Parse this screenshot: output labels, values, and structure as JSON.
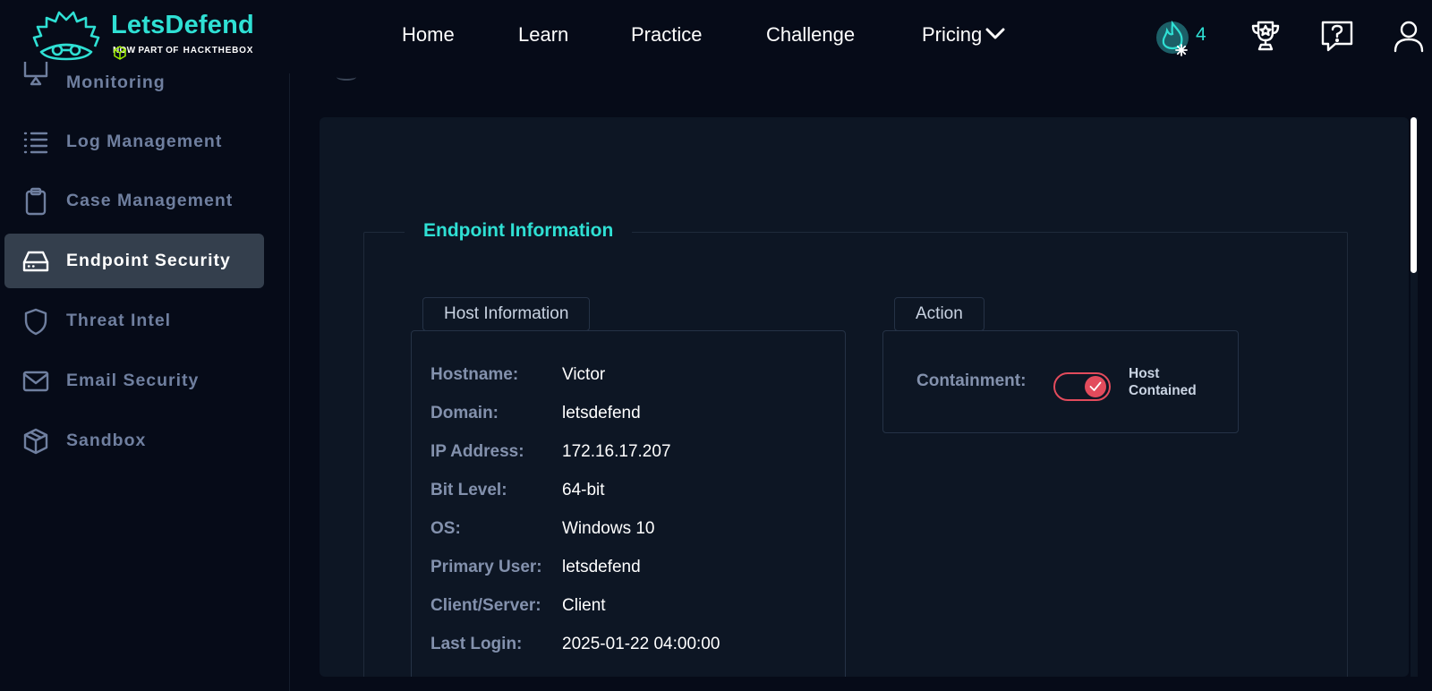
{
  "brand": {
    "name": "LetsDefend",
    "tagline": "NOW PART OF",
    "partner": "HACKTHEBOX"
  },
  "nav": {
    "items": [
      {
        "label": "Home"
      },
      {
        "label": "Learn"
      },
      {
        "label": "Practice"
      },
      {
        "label": "Challenge"
      },
      {
        "label": "Pricing"
      }
    ]
  },
  "streak": {
    "count": "4"
  },
  "sidebar": {
    "items": [
      {
        "label": "Monitoring",
        "icon": "monitor-icon"
      },
      {
        "label": "Log Management",
        "icon": "list-icon"
      },
      {
        "label": "Case Management",
        "icon": "clipboard-icon"
      },
      {
        "label": "Endpoint Security",
        "icon": "hard-drive-icon",
        "active": true
      },
      {
        "label": "Threat Intel",
        "icon": "shield-icon"
      },
      {
        "label": "Email Security",
        "icon": "mail-icon"
      },
      {
        "label": "Sandbox",
        "icon": "cube-icon"
      }
    ]
  },
  "endpoint": {
    "title": "Endpoint Information",
    "host_info": {
      "title": "Host Information",
      "rows": [
        {
          "key": "Hostname:",
          "value": "Victor"
        },
        {
          "key": "Domain:",
          "value": "letsdefend"
        },
        {
          "key": "IP Address:",
          "value": "172.16.17.207"
        },
        {
          "key": "Bit Level:",
          "value": "64-bit"
        },
        {
          "key": "OS:",
          "value": "Windows 10"
        },
        {
          "key": "Primary User:",
          "value": "letsdefend"
        },
        {
          "key": "Client/Server:",
          "value": "Client"
        },
        {
          "key": "Last Login:",
          "value": "2025-01-22 04:00:00"
        }
      ]
    },
    "action": {
      "title": "Action",
      "containment_label": "Containment:",
      "status_line1": "Host",
      "status_line2": "Contained",
      "contained": true
    }
  },
  "colors": {
    "accent": "#2fe0d4",
    "toggle_on": "#e24b5c",
    "background": "#060b18",
    "panel": "#0d1624"
  }
}
